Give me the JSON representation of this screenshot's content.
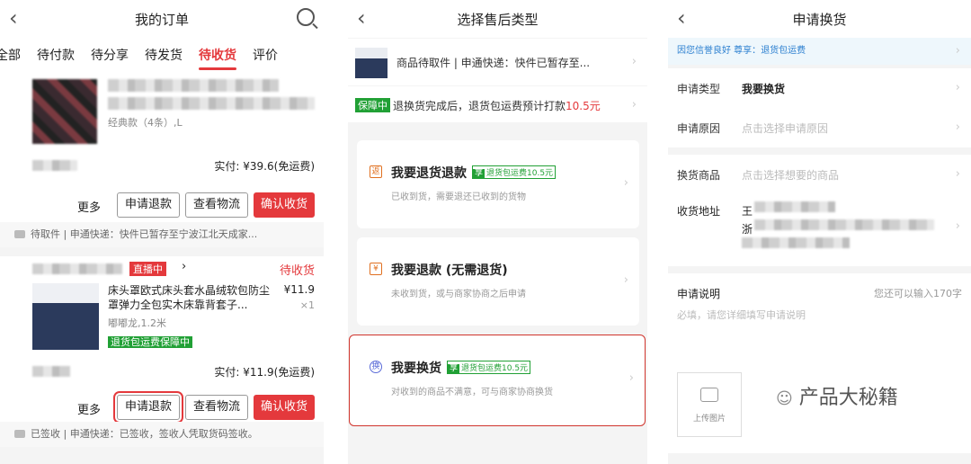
{
  "panel1": {
    "title": "我的订单",
    "tabs": [
      "全部",
      "待付款",
      "待分享",
      "待发货",
      "待收货",
      "评价"
    ],
    "order1": {
      "variant": "经典款（4条）,L",
      "paid": "实付: ¥39.6(免运费)",
      "more": "更多",
      "refund": "申请退款",
      "logistics": "查看物流",
      "confirm": "确认收货",
      "status_strip": "待取件 | 申通快递：快件已暂存至宁波江北天成家..."
    },
    "order2": {
      "live_badge": "直播中",
      "status": "待收货",
      "product_title": "床头罩欧式床头套水晶绒软包防尘罩弹力全包实木床靠背套子...",
      "price": "¥11.9",
      "qty": "×1",
      "variant": "嘟嘟龙,1.2米",
      "guarantee": "退货包运费保障中",
      "paid": "实付: ¥11.9(免运费)",
      "more": "更多",
      "refund": "申请退款",
      "logistics": "查看物流",
      "confirm": "确认收货",
      "status_strip": "已签收 | 申通快递：已签收，签收人凭取货码签收。"
    }
  },
  "panel2": {
    "title": "选择售后类型",
    "pending": "商品待取件 | 申通快递：快件已暂存至...",
    "guarantee_tag": "保障中",
    "guarantee_text": "退换货完成后，退货包运费预计打款",
    "guarantee_amount": "10.5元",
    "options": [
      {
        "icon": "返",
        "title": "我要退货退款",
        "badge_a": "享",
        "badge_b": "退货包运费10.5元",
        "desc": "已收到货，需要退还已收到的货物"
      },
      {
        "icon": "¥",
        "title": "我要退款 (无需退货)",
        "desc": "未收到货，或与商家协商之后申请"
      },
      {
        "icon": "换",
        "title": "我要换货",
        "badge_a": "享",
        "badge_b": "退货包运费10.5元",
        "desc": "对收到的商品不满意，可与商家协商换货"
      }
    ]
  },
  "panel3": {
    "title": "申请换货",
    "notice_a": "因您信誉良好 尊享：",
    "notice_b": "退货包运费",
    "type_label": "申请类型",
    "type_value": "我要换货",
    "reason_label": "申请原因",
    "reason_placeholder": "点击选择申请原因",
    "goods_label": "换货商品",
    "goods_placeholder": "点击选择想要的商品",
    "address_label": "收货地址",
    "address_partial_1": "王",
    "address_partial_2": "浙",
    "desc_label": "申请说明",
    "desc_counter": "您还可以输入170字",
    "desc_placeholder": "必填，请您详细填写申请说明",
    "upload_label": "上传图片"
  },
  "watermark": "产品大秘籍"
}
